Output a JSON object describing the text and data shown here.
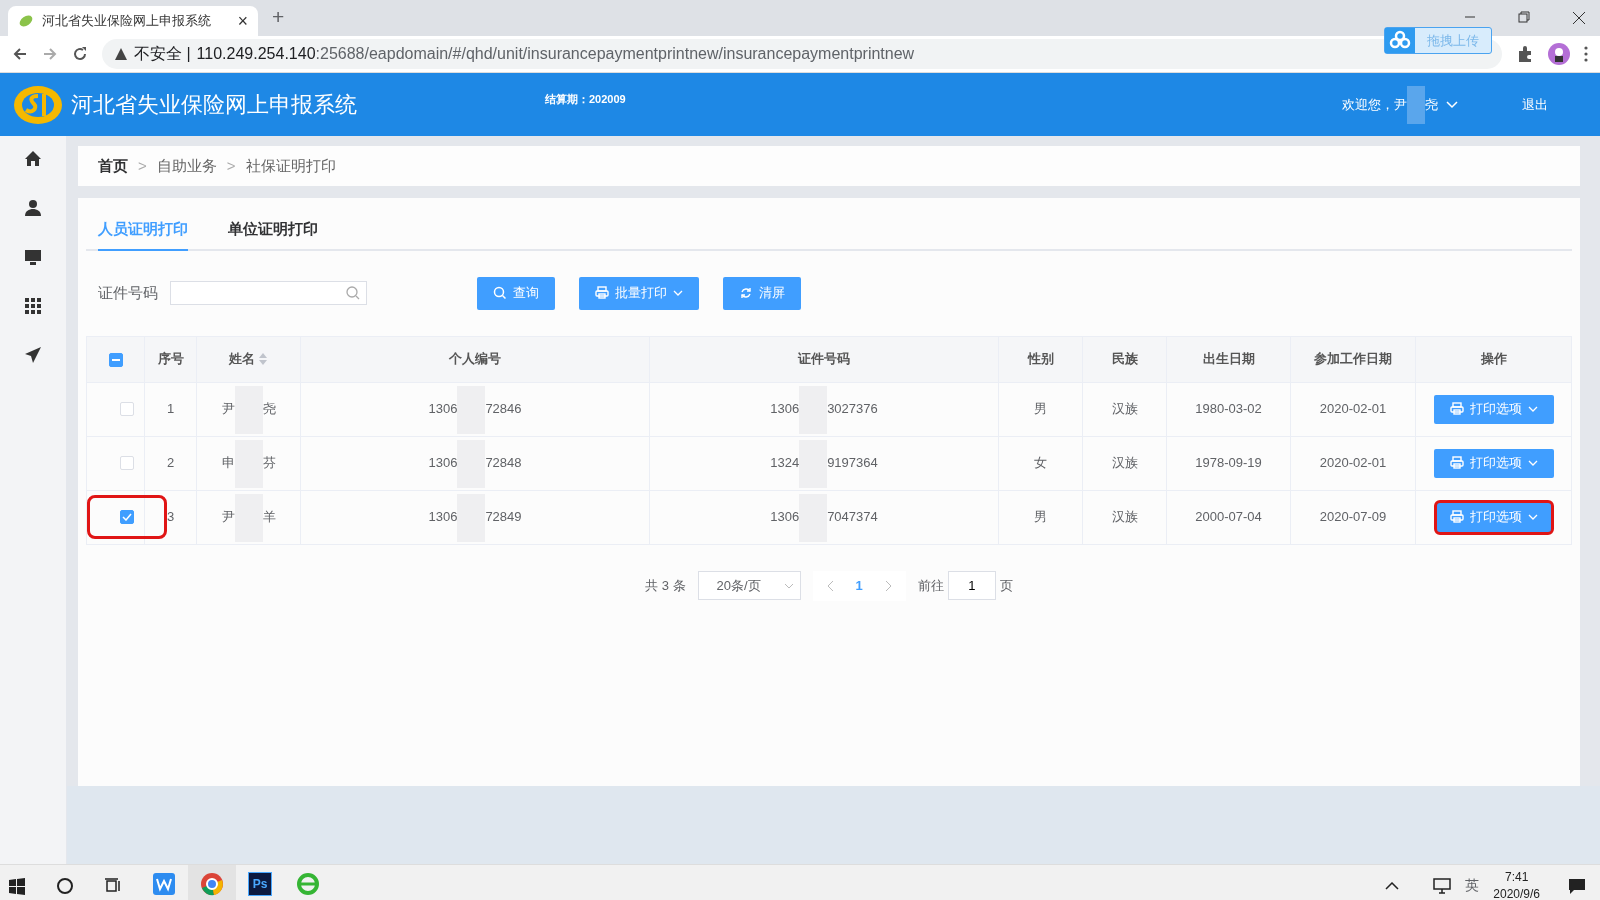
{
  "browser": {
    "tab_title": "河北省失业保险网上申报系统",
    "tab_close": "×",
    "new_tab": "+",
    "security": "不安全 |",
    "url_host": "110.249.254.140",
    "url_rest": ":25688/eapdomain/#/qhd/unit/insurancepaymentprintnew/insurancepaymentprintnew",
    "upload_button": "拖拽上传"
  },
  "header": {
    "title": "河北省失业保险网上申报系统",
    "period_label": "结算期：",
    "period": "202009",
    "welcome": "欢迎您，尹",
    "welcome_end": "尧",
    "logout": "退出"
  },
  "sidebar": {
    "items": [
      {
        "kind": "home"
      },
      {
        "kind": "user"
      },
      {
        "kind": "monitor"
      },
      {
        "kind": "grid"
      },
      {
        "kind": "send"
      }
    ]
  },
  "breadcrumb": {
    "separator": ">",
    "items": [
      {
        "label": "首页"
      },
      {
        "label": "自助业务"
      },
      {
        "label": "社保证明打印"
      }
    ]
  },
  "tabs": [
    {
      "label": "人员证明打印",
      "selected": true
    },
    {
      "label": "单位证明打印",
      "selected": false
    }
  ],
  "search": {
    "label": "证件号码"
  },
  "buttons": [
    {
      "kind": "search",
      "label": "查询",
      "dropdown": false
    },
    {
      "kind": "print",
      "label": "批量打印",
      "dropdown": true
    },
    {
      "kind": "refresh",
      "label": "清屏",
      "dropdown": false
    }
  ],
  "table": {
    "select_all": {
      "indeterminate": true
    },
    "columns": [
      {
        "label": "序号",
        "sortable": false
      },
      {
        "label": "姓名",
        "sortable": true
      },
      {
        "label": "个人编号",
        "sortable": false
      },
      {
        "label": "证件号码",
        "sortable": false
      },
      {
        "label": "性别",
        "sortable": false
      },
      {
        "label": "民族",
        "sortable": false
      },
      {
        "label": "出生日期",
        "sortable": false
      },
      {
        "label": "参加工作日期",
        "sortable": false
      },
      {
        "label": "操作",
        "sortable": false
      }
    ],
    "rows": [
      {
        "checked": false,
        "highlighted": false,
        "index": "1",
        "name_start": "尹",
        "name_end": "尧",
        "personal_no_start": "1306",
        "personal_no_end": "72846",
        "id_start": "1306",
        "id_end": "3027376",
        "gender": "男",
        "ethnicity": "汉族",
        "birth_date": "1980-03-02",
        "work_date": "2020-02-01",
        "action": "打印选项",
        "action_highlighted": false
      },
      {
        "checked": false,
        "highlighted": false,
        "index": "2",
        "name_start": "申",
        "name_end": "芬",
        "personal_no_start": "1306",
        "personal_no_end": "72848",
        "id_start": "1324",
        "id_end": "9197364",
        "gender": "女",
        "ethnicity": "汉族",
        "birth_date": "1978-09-19",
        "work_date": "2020-02-01",
        "action": "打印选项",
        "action_highlighted": false
      },
      {
        "checked": true,
        "highlighted": true,
        "index": "3",
        "name_start": "尹",
        "name_end": "羊",
        "personal_no_start": "1306",
        "personal_no_end": "72849",
        "id_start": "1306",
        "id_end": "7047374",
        "gender": "男",
        "ethnicity": "汉族",
        "birth_date": "2000-07-04",
        "work_date": "2020-07-09",
        "action": "打印选项",
        "action_highlighted": true
      }
    ]
  },
  "pagination": {
    "total": "共 3 条",
    "page_size": "20条/页",
    "pages": [
      {
        "label": "1",
        "selected": true
      }
    ],
    "goto_label": "前往",
    "goto_value": "1",
    "page_suffix": "页"
  },
  "taskbar": {
    "apps": [
      {
        "kind": "wps",
        "active": false
      },
      {
        "kind": "chrome",
        "active": true
      },
      {
        "kind": "ps",
        "active": false
      },
      {
        "kind": "ie",
        "active": false
      }
    ],
    "ps_label": "Ps",
    "ime": "英",
    "time": "7:41",
    "date": "2020/9/6"
  }
}
